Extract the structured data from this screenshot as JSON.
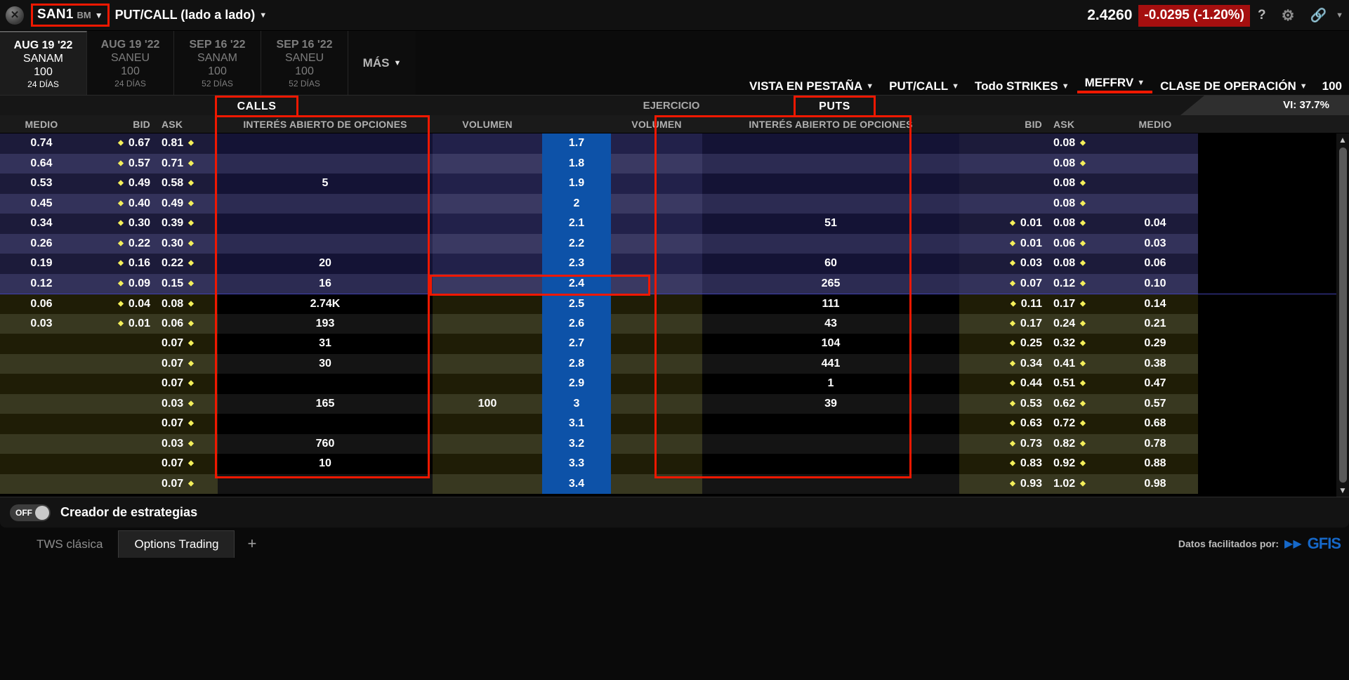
{
  "topbar": {
    "symbol": "SAN1",
    "exchange": "BM",
    "view_mode": "PUT/CALL (lado a lado)",
    "last_price": "2.4260",
    "change": "-0.0295 (-1.20%)",
    "change_color": "#a50f0f",
    "help_icon": "?",
    "gear_icon": "gear-icon",
    "link_icon": "link-icon"
  },
  "expiries": [
    {
      "date": "AUG 19 '22",
      "class": "SANAM",
      "multiplier": "100",
      "days": "24 DÍAS",
      "active": true
    },
    {
      "date": "AUG 19 '22",
      "class": "SANEU",
      "multiplier": "100",
      "days": "24 DÍAS",
      "active": false
    },
    {
      "date": "SEP 16 '22",
      "class": "SANAM",
      "multiplier": "100",
      "days": "52 DÍAS",
      "active": false
    },
    {
      "date": "SEP 16 '22",
      "class": "SANEU",
      "multiplier": "100",
      "days": "52 DÍAS",
      "active": false
    }
  ],
  "more_label": "MÁS",
  "toolbar": {
    "items": [
      {
        "label": "VISTA EN PESTAÑA",
        "caret": true,
        "highlighted": false
      },
      {
        "label": "PUT/CALL",
        "caret": true,
        "highlighted": false
      },
      {
        "label": "Todo STRIKES",
        "caret": true,
        "highlighted": false
      },
      {
        "label": "MEFFRV",
        "caret": true,
        "highlighted": true
      },
      {
        "label": "CLASE DE OPERACIÓN",
        "caret": true,
        "highlighted": false
      }
    ],
    "multiplier": "100"
  },
  "banners": {
    "calls": "CALLS",
    "puts": "PUTS",
    "ejercicio": "EJERCICIO",
    "vi": "VI: 37.7%"
  },
  "table": {
    "headers": {
      "left": [
        "MEDIO",
        "BID",
        "ASK",
        "INTERÉS ABIERTO DE OPCIONES",
        "VOLUMEN"
      ],
      "strike": "EJERCICIO",
      "right": [
        "VOLUMEN",
        "INTERÉS ABIERTO DE OPCIONES",
        "BID",
        "ASK",
        "MEDIO"
      ]
    },
    "rows": [
      {
        "strike": "1.7",
        "itm": true,
        "band": "a",
        "call": {
          "medio": "0.74",
          "bid": "0.67",
          "ask": "0.81",
          "oi": "",
          "vol": ""
        },
        "put": {
          "vol": "",
          "oi": "",
          "bid": "",
          "ask": "0.08",
          "medio": ""
        }
      },
      {
        "strike": "1.8",
        "itm": true,
        "band": "b",
        "call": {
          "medio": "0.64",
          "bid": "0.57",
          "ask": "0.71",
          "oi": "",
          "vol": ""
        },
        "put": {
          "vol": "",
          "oi": "",
          "bid": "",
          "ask": "0.08",
          "medio": ""
        }
      },
      {
        "strike": "1.9",
        "itm": true,
        "band": "a",
        "call": {
          "medio": "0.53",
          "bid": "0.49",
          "ask": "0.58",
          "oi": "5",
          "vol": ""
        },
        "put": {
          "vol": "",
          "oi": "",
          "bid": "",
          "ask": "0.08",
          "medio": ""
        }
      },
      {
        "strike": "2",
        "itm": true,
        "band": "b",
        "call": {
          "medio": "0.45",
          "bid": "0.40",
          "ask": "0.49",
          "oi": "",
          "vol": ""
        },
        "put": {
          "vol": "",
          "oi": "",
          "bid": "",
          "ask": "0.08",
          "medio": ""
        }
      },
      {
        "strike": "2.1",
        "itm": true,
        "band": "a",
        "call": {
          "medio": "0.34",
          "bid": "0.30",
          "ask": "0.39",
          "oi": "",
          "vol": ""
        },
        "put": {
          "vol": "",
          "oi": "51",
          "bid": "0.01",
          "ask": "0.08",
          "medio": "0.04"
        }
      },
      {
        "strike": "2.2",
        "itm": true,
        "band": "b",
        "call": {
          "medio": "0.26",
          "bid": "0.22",
          "ask": "0.30",
          "oi": "",
          "vol": ""
        },
        "put": {
          "vol": "",
          "oi": "",
          "bid": "0.01",
          "ask": "0.06",
          "medio": "0.03"
        }
      },
      {
        "strike": "2.3",
        "itm": true,
        "band": "a",
        "call": {
          "medio": "0.19",
          "bid": "0.16",
          "ask": "0.22",
          "oi": "20",
          "vol": ""
        },
        "put": {
          "vol": "",
          "oi": "60",
          "bid": "0.03",
          "ask": "0.08",
          "medio": "0.06"
        }
      },
      {
        "strike": "2.4",
        "itm": true,
        "band": "b",
        "call": {
          "medio": "0.12",
          "bid": "0.09",
          "ask": "0.15",
          "oi": "16",
          "vol": ""
        },
        "put": {
          "vol": "",
          "oi": "265",
          "bid": "0.07",
          "ask": "0.12",
          "medio": "0.10"
        }
      },
      {
        "strike": "2.5",
        "itm": false,
        "band": "a",
        "boundary": true,
        "call": {
          "medio": "0.06",
          "bid": "0.04",
          "ask": "0.08",
          "oi": "2.74K",
          "vol": ""
        },
        "put": {
          "vol": "",
          "oi": "111",
          "bid": "0.11",
          "ask": "0.17",
          "medio": "0.14"
        }
      },
      {
        "strike": "2.6",
        "itm": false,
        "band": "b",
        "call": {
          "medio": "0.03",
          "bid": "0.01",
          "ask": "0.06",
          "oi": "193",
          "vol": ""
        },
        "put": {
          "vol": "",
          "oi": "43",
          "bid": "0.17",
          "ask": "0.24",
          "medio": "0.21"
        }
      },
      {
        "strike": "2.7",
        "itm": false,
        "band": "a",
        "call": {
          "medio": "",
          "bid": "",
          "ask": "0.07",
          "oi": "31",
          "vol": ""
        },
        "put": {
          "vol": "",
          "oi": "104",
          "bid": "0.25",
          "ask": "0.32",
          "medio": "0.29"
        }
      },
      {
        "strike": "2.8",
        "itm": false,
        "band": "b",
        "call": {
          "medio": "",
          "bid": "",
          "ask": "0.07",
          "oi": "30",
          "vol": ""
        },
        "put": {
          "vol": "",
          "oi": "441",
          "bid": "0.34",
          "ask": "0.41",
          "medio": "0.38"
        }
      },
      {
        "strike": "2.9",
        "itm": false,
        "band": "a",
        "call": {
          "medio": "",
          "bid": "",
          "ask": "0.07",
          "oi": "",
          "vol": ""
        },
        "put": {
          "vol": "",
          "oi": "1",
          "bid": "0.44",
          "ask": "0.51",
          "medio": "0.47"
        }
      },
      {
        "strike": "3",
        "itm": false,
        "band": "b",
        "call": {
          "medio": "",
          "bid": "",
          "ask": "0.03",
          "oi": "165",
          "vol": "100"
        },
        "put": {
          "vol": "",
          "oi": "39",
          "bid": "0.53",
          "ask": "0.62",
          "medio": "0.57"
        }
      },
      {
        "strike": "3.1",
        "itm": false,
        "band": "a",
        "call": {
          "medio": "",
          "bid": "",
          "ask": "0.07",
          "oi": "",
          "vol": ""
        },
        "put": {
          "vol": "",
          "oi": "",
          "bid": "0.63",
          "ask": "0.72",
          "medio": "0.68"
        }
      },
      {
        "strike": "3.2",
        "itm": false,
        "band": "b",
        "call": {
          "medio": "",
          "bid": "",
          "ask": "0.03",
          "oi": "760",
          "vol": ""
        },
        "put": {
          "vol": "",
          "oi": "",
          "bid": "0.73",
          "ask": "0.82",
          "medio": "0.78"
        }
      },
      {
        "strike": "3.3",
        "itm": false,
        "band": "a",
        "call": {
          "medio": "",
          "bid": "",
          "ask": "0.07",
          "oi": "10",
          "vol": ""
        },
        "put": {
          "vol": "",
          "oi": "",
          "bid": "0.83",
          "ask": "0.92",
          "medio": "0.88"
        }
      },
      {
        "strike": "3.4",
        "itm": false,
        "band": "b",
        "call": {
          "medio": "",
          "bid": "",
          "ask": "0.07",
          "oi": "",
          "vol": ""
        },
        "put": {
          "vol": "",
          "oi": "",
          "bid": "0.93",
          "ask": "1.02",
          "medio": "0.98"
        }
      }
    ]
  },
  "strategy": {
    "toggle_state": "OFF",
    "label": "Creador de estrategias"
  },
  "bottom_tabs": [
    {
      "label": "TWS clásica",
      "active": false
    },
    {
      "label": "Options Trading",
      "active": true
    }
  ],
  "add_tab": "+",
  "provider": {
    "text": "Datos facilitados por:",
    "name": "GFIS"
  }
}
